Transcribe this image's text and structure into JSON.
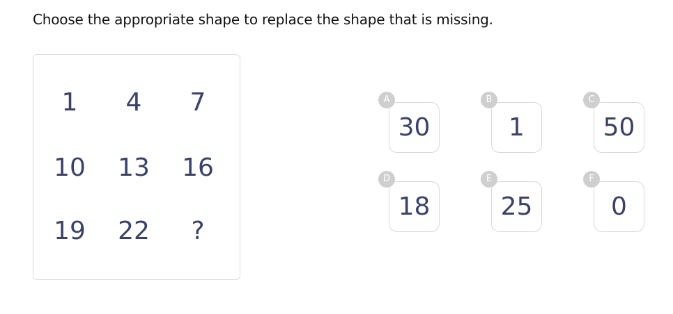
{
  "question": "Choose the appropriate shape to replace the shape that is missing.",
  "grid": [
    [
      "1",
      "4",
      "7"
    ],
    [
      "10",
      "13",
      "16"
    ],
    [
      "19",
      "22",
      "?"
    ]
  ],
  "options": [
    {
      "letter": "A",
      "value": "30"
    },
    {
      "letter": "B",
      "value": "1"
    },
    {
      "letter": "C",
      "value": "50"
    },
    {
      "letter": "D",
      "value": "18"
    },
    {
      "letter": "E",
      "value": "25"
    },
    {
      "letter": "F",
      "value": "0"
    }
  ]
}
